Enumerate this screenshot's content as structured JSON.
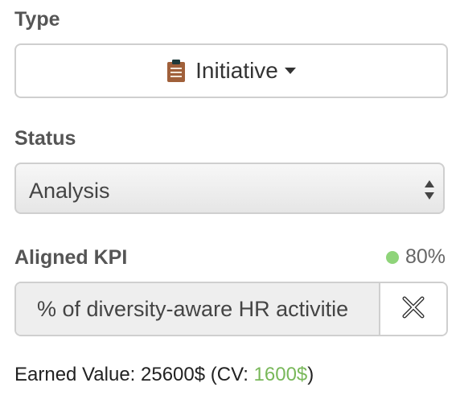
{
  "type_field": {
    "label": "Type",
    "value": "Initiative",
    "icon": "clipboard-icon"
  },
  "status_field": {
    "label": "Status",
    "value": "Analysis"
  },
  "kpi_field": {
    "label": "Aligned KPI",
    "percent": "80%",
    "status_color": "#8fd47a",
    "value": "% of diversity-aware HR activitie",
    "clear_icon": "close-icon"
  },
  "earned_value": {
    "prefix": "Earned Value: 25600$ (CV: ",
    "cv": "1600$",
    "suffix": ")",
    "cv_color": "#79b85a"
  }
}
